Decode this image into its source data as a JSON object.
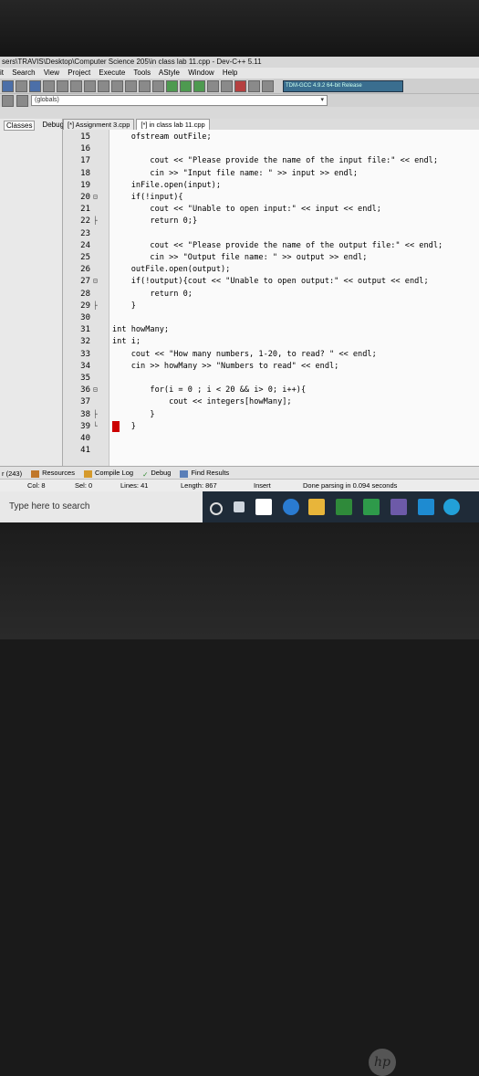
{
  "window": {
    "title": "sers\\TRAVIS\\Desktop\\Computer Science 205\\in class lab 11.cpp - Dev-C++ 5.11"
  },
  "menu": [
    "it",
    "Search",
    "View",
    "Project",
    "Execute",
    "Tools",
    "AStyle",
    "Window",
    "Help"
  ],
  "toolbar": {
    "compiler": "TDM-GCC 4.9.2 64-bit Release",
    "scope": "(globals)"
  },
  "left_panel": {
    "tabs": [
      "Classes",
      "Debug"
    ]
  },
  "editor": {
    "tabs": [
      "[*] Assignment 3.cpp",
      "[*] in class lab 11.cpp"
    ],
    "lines": [
      {
        "n": "15",
        "fold": "",
        "text": "    ofstream outFile;"
      },
      {
        "n": "16",
        "fold": "",
        "text": ""
      },
      {
        "n": "17",
        "fold": "",
        "text": "        cout << \"Please provide the name of the input file:\" << endl;"
      },
      {
        "n": "18",
        "fold": "",
        "text": "        cin >> \"Input file name: \" >> input >> endl;"
      },
      {
        "n": "19",
        "fold": "",
        "text": "    inFile.open(input);"
      },
      {
        "n": "20",
        "fold": "⊟",
        "text": "    if(!input){"
      },
      {
        "n": "21",
        "fold": "",
        "text": "        cout << \"Unable to open input:\" << input << endl;"
      },
      {
        "n": "22",
        "fold": "├",
        "text": "        return 0;}"
      },
      {
        "n": "23",
        "fold": "",
        "text": ""
      },
      {
        "n": "24",
        "fold": "",
        "text": "        cout << \"Please provide the name of the output file:\" << endl;"
      },
      {
        "n": "25",
        "fold": "",
        "text": "        cin >> \"Output file name: \" >> output >> endl;"
      },
      {
        "n": "26",
        "fold": "",
        "text": "    outFile.open(output);"
      },
      {
        "n": "27",
        "fold": "⊟",
        "text": "    if(!output){cout << \"Unable to open output:\" << output << endl;"
      },
      {
        "n": "28",
        "fold": "",
        "text": "        return 0;"
      },
      {
        "n": "29",
        "fold": "├",
        "text": "    }"
      },
      {
        "n": "30",
        "fold": "",
        "text": ""
      },
      {
        "n": "31",
        "fold": "",
        "text": "int howMany;"
      },
      {
        "n": "32",
        "fold": "",
        "text": "int i;"
      },
      {
        "n": "33",
        "fold": "",
        "text": "    cout << \"How many numbers, 1-20, to read? \" << endl;"
      },
      {
        "n": "34",
        "fold": "",
        "text": "    cin >> howMany >> \"Numbers to read\" << endl;"
      },
      {
        "n": "35",
        "fold": "",
        "text": ""
      },
      {
        "n": "36",
        "fold": "⊟",
        "text": "        for(i = 0 ; i < 20 && i> 0; i++){"
      },
      {
        "n": "37",
        "fold": "",
        "text": "            cout << integers[howMany];"
      },
      {
        "n": "38",
        "fold": "├",
        "text": "        }"
      },
      {
        "n": "39",
        "fold": "└",
        "text": "    }"
      },
      {
        "n": "40",
        "fold": "",
        "text": ""
      },
      {
        "n": "41",
        "fold": "",
        "text": ""
      }
    ]
  },
  "messages": {
    "count": "r (243)",
    "tabs": [
      "Resources",
      "Compile Log",
      "Debug",
      "Find Results"
    ]
  },
  "status": {
    "col": "Col:   8",
    "sel": "Sel:   0",
    "lines": "Lines:   41",
    "length": "Length:   867",
    "mode": "Insert",
    "message": "Done parsing in 0.094 seconds"
  },
  "taskbar": {
    "search_placeholder": "Type here to search"
  },
  "brand": "hp"
}
